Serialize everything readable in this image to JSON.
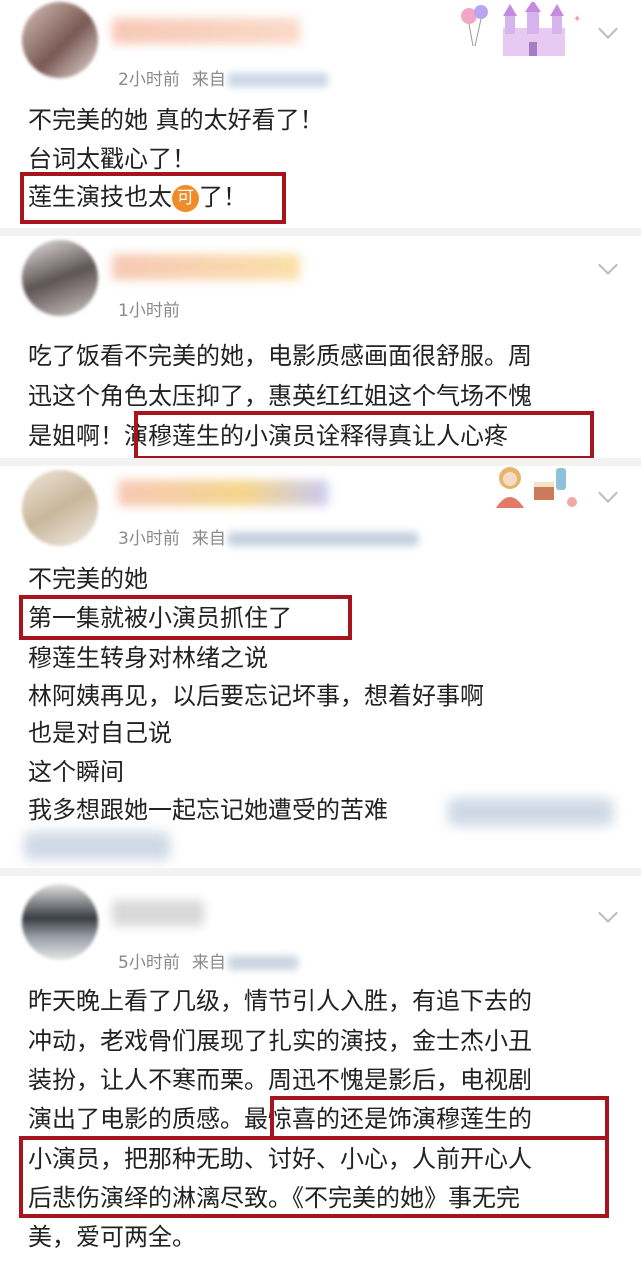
{
  "posts": [
    {
      "time": "2小时前",
      "source_prefix": "来自",
      "lines": [
        "不完美的她 真的太好看了！",
        "台词太戳心了！"
      ],
      "highlight_before": "莲生演技也太",
      "icon_label": "可",
      "highlight_after": "了！"
    },
    {
      "time": "1小时前",
      "lines": [
        "吃了饭看不完美的她，电影质感画面很舒服。周",
        "迅这个角色太压抑了，惠英红红姐这个气场不愧"
      ],
      "line3_before": "是姐啊！",
      "line3_highlight": "演穆莲生的小演员诠释得真让人心疼"
    },
    {
      "time": "3小时前",
      "source_prefix": "来自",
      "lines": [
        "不完美的她",
        "第一集就被小演员抓住了",
        "穆莲生转身对林绪之说",
        "林阿姨再见，以后要忘记坏事，想着好事啊",
        "也是对自己说",
        "这个瞬间",
        "我多想跟她一起忘记她遭受的苦难"
      ]
    },
    {
      "time": "5小时前",
      "source_prefix": "来自",
      "lines": [
        "昨天晚上看了几级，情节引人入胜，有追下去的",
        "冲动，老戏骨们展现了扎实的演技，金士杰小丑",
        "装扮，让人不寒而栗。周迅不愧是影后，电视剧"
      ],
      "line4_before": "演出了电影的质感。",
      "line4_highlight": "最惊喜的还是饰演穆莲生的",
      "line5": "小演员，把那种无助、讨好、小心，人前开心人",
      "line6": "后悲伤演绎的淋漓尽致。《不完美的她》事无完",
      "line7": "美，爱可两全。"
    }
  ],
  "colors": {
    "highlight_border": "#a8141e",
    "meta_text": "#8a8a8a",
    "icon_bg": "#f08c28"
  }
}
